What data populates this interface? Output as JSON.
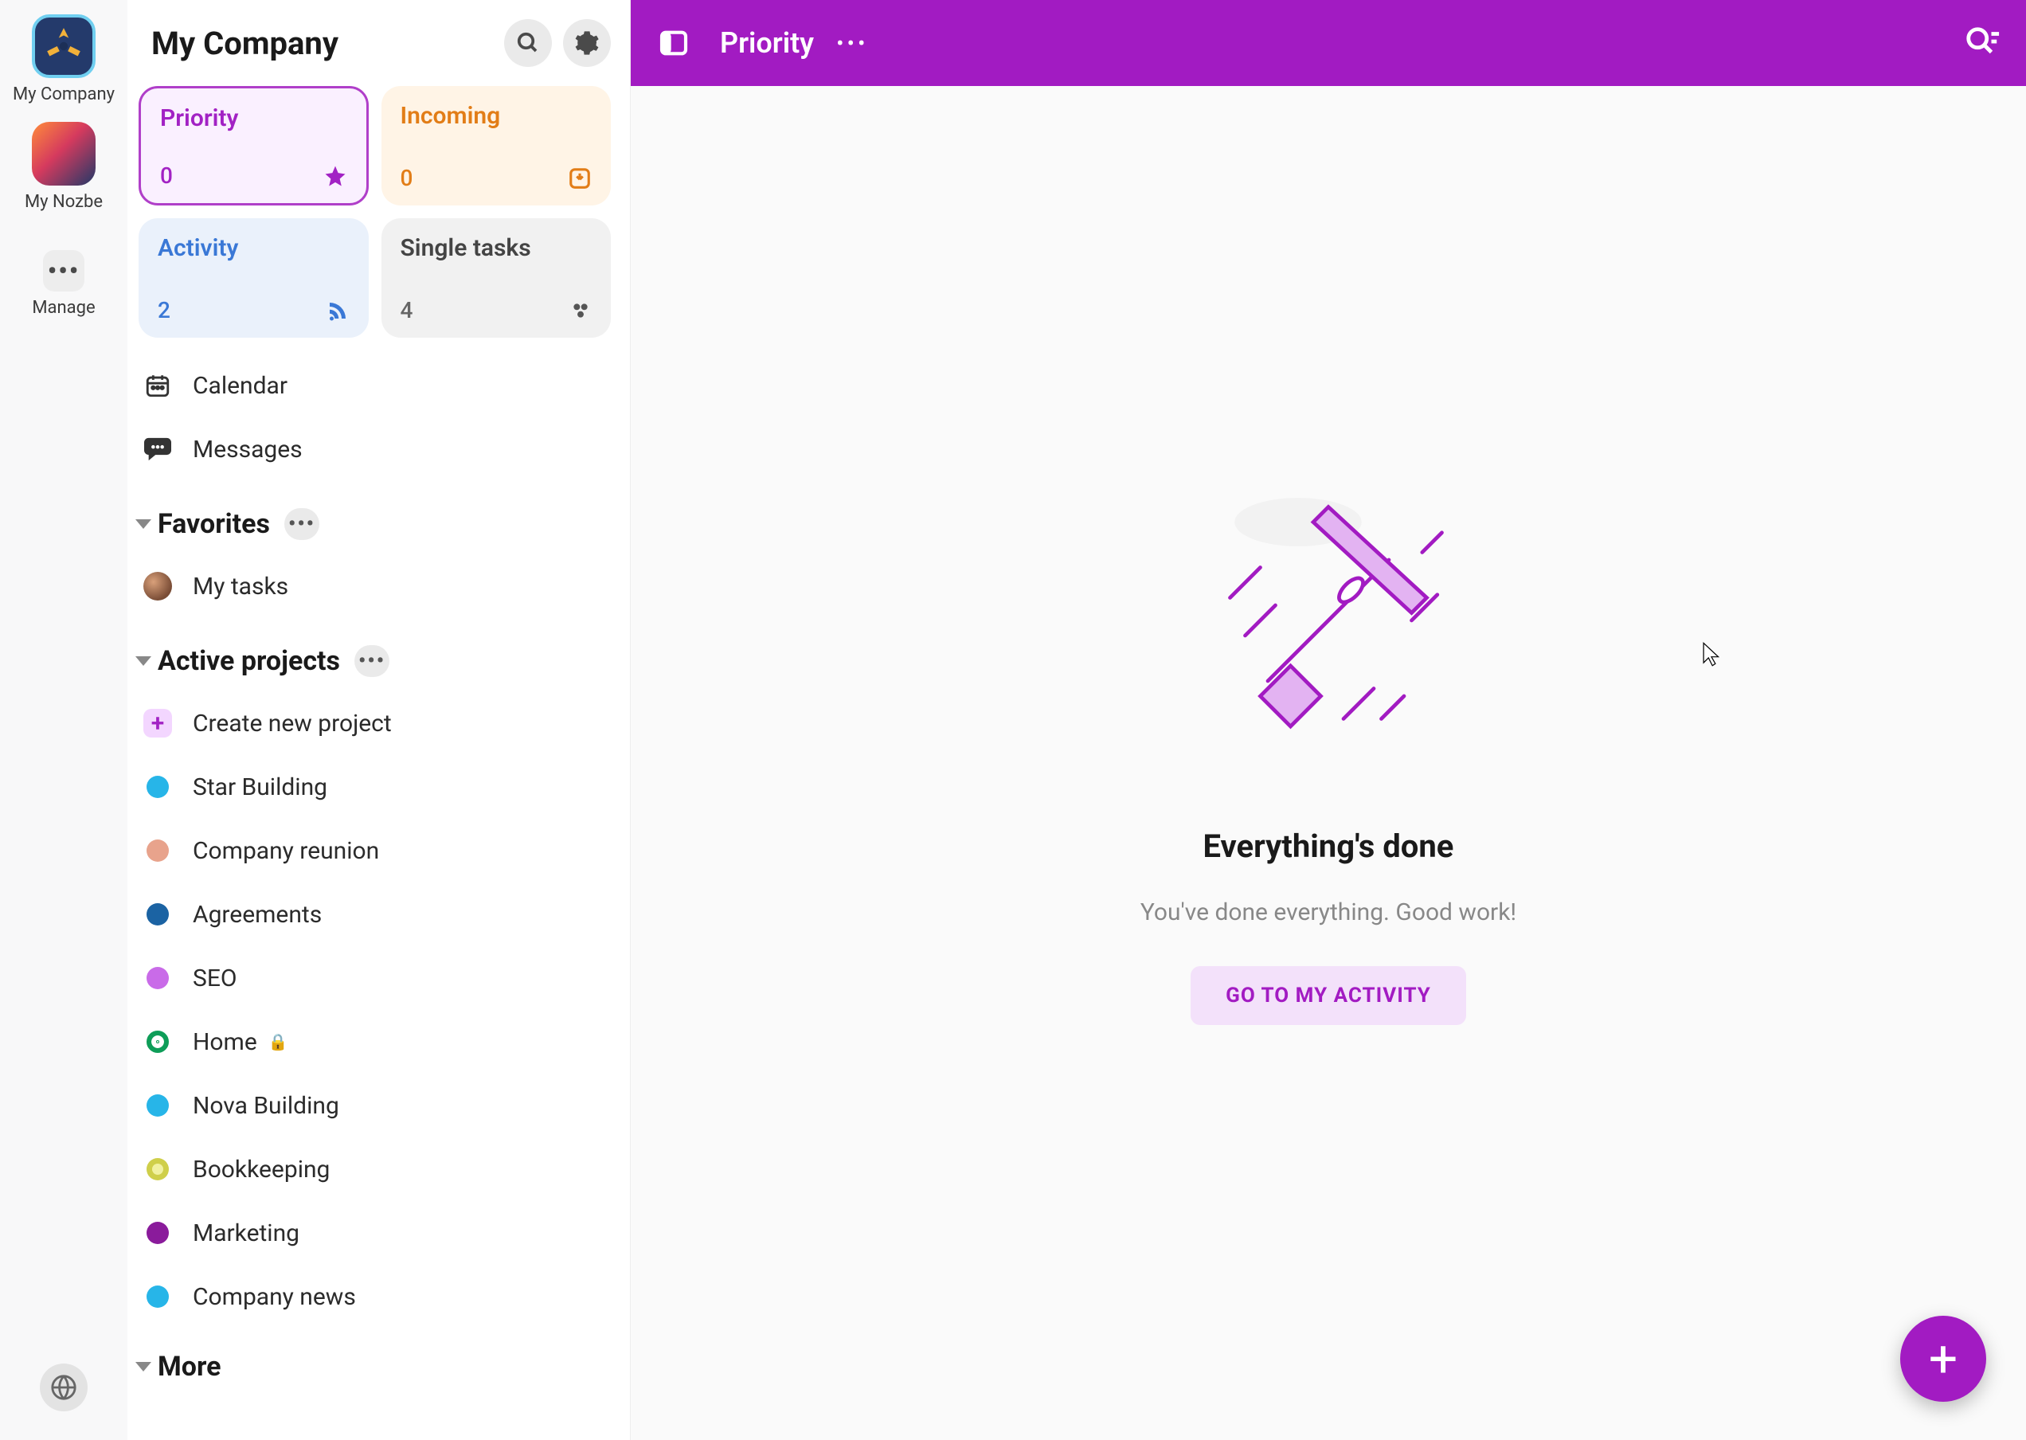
{
  "rail": {
    "company_label": "My Company",
    "nozbe_label": "My Nozbe",
    "manage_label": "Manage"
  },
  "sidebar": {
    "title": "My Company",
    "cards": {
      "priority": {
        "label": "Priority",
        "count": "0"
      },
      "incoming": {
        "label": "Incoming",
        "count": "0"
      },
      "activity": {
        "label": "Activity",
        "count": "2"
      },
      "single": {
        "label": "Single tasks",
        "count": "4"
      }
    },
    "nav": {
      "calendar": "Calendar",
      "messages": "Messages"
    },
    "favorites": {
      "title": "Favorites",
      "my_tasks": "My tasks"
    },
    "active": {
      "title": "Active projects",
      "create": "Create new project",
      "items": [
        {
          "label": "Star Building",
          "color": "d-cyan"
        },
        {
          "label": "Company reunion",
          "color": "d-peach"
        },
        {
          "label": "Agreements",
          "color": "d-navy"
        },
        {
          "label": "SEO",
          "color": "d-violet"
        },
        {
          "label": "Home",
          "color": "d-green",
          "locked": true
        },
        {
          "label": "Nova Building",
          "color": "d-cyan"
        },
        {
          "label": "Bookkeeping",
          "color": "d-olive"
        },
        {
          "label": "Marketing",
          "color": "d-purple"
        },
        {
          "label": "Company news",
          "color": "d-cyan"
        }
      ]
    },
    "more": {
      "title": "More"
    }
  },
  "topbar": {
    "title": "Priority"
  },
  "empty": {
    "title": "Everything's done",
    "subtitle": "You've done everything. Good work!",
    "button": "GO TO MY ACTIVITY"
  },
  "colors": {
    "brand": "#a21bc2",
    "incoming": "#e27d17",
    "activity": "#3a78d6"
  }
}
